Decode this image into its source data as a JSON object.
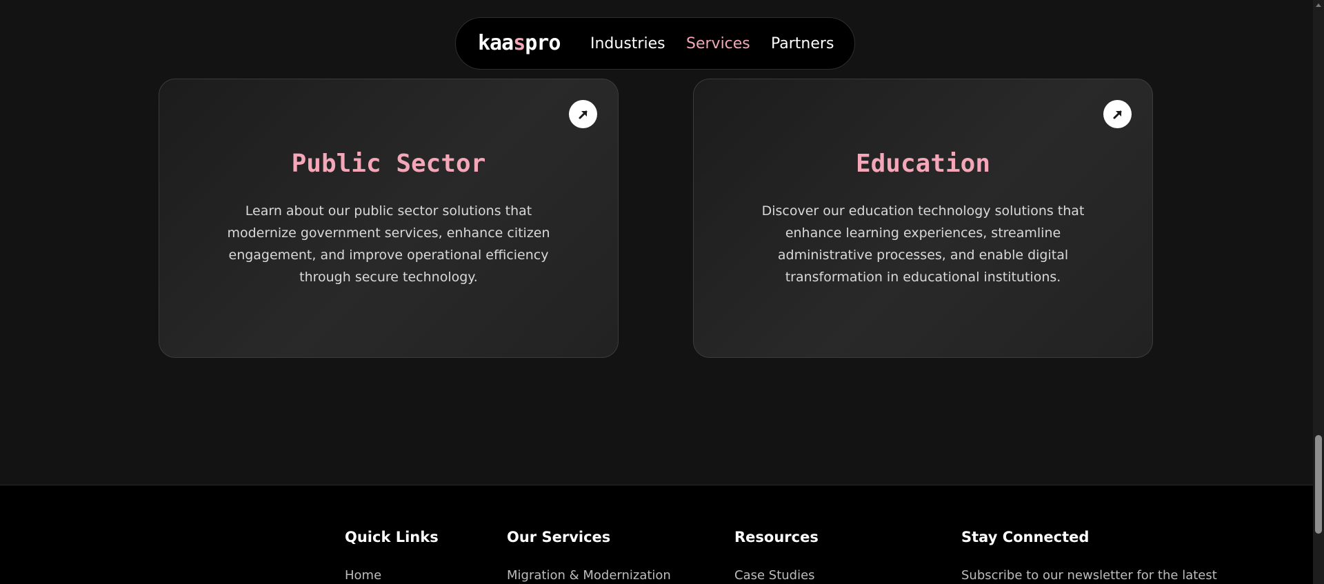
{
  "nav": {
    "logo_prefix": "kaa",
    "logo_accent": "s",
    "logo_suffix": "pro",
    "links": [
      {
        "label": "Industries",
        "active": false
      },
      {
        "label": "Services",
        "active": true
      },
      {
        "label": "Partners",
        "active": false
      }
    ]
  },
  "cards": [
    {
      "title": "Public Sector",
      "description": "Learn about our public sector solutions that modernize government services, enhance citizen engagement, and improve operational efficiency through secure technology.",
      "icon": "arrow-up-right-icon"
    },
    {
      "title": "Education",
      "description": "Discover our education technology solutions that enhance learning experiences, streamline administrative processes, and enable digital transformation in educational institutions.",
      "icon": "arrow-up-right-icon"
    }
  ],
  "footer": {
    "columns": [
      {
        "heading": "Quick Links",
        "first_item": "Home"
      },
      {
        "heading": "Our Services",
        "first_item": "Migration & Modernization"
      },
      {
        "heading": "Resources",
        "first_item": "Case Studies"
      },
      {
        "heading": "Stay Connected",
        "first_item": "Subscribe to our newsletter for the latest"
      }
    ]
  },
  "colors": {
    "accent": "#f4a7b9",
    "background": "#141314",
    "footer_background": "#000000"
  }
}
